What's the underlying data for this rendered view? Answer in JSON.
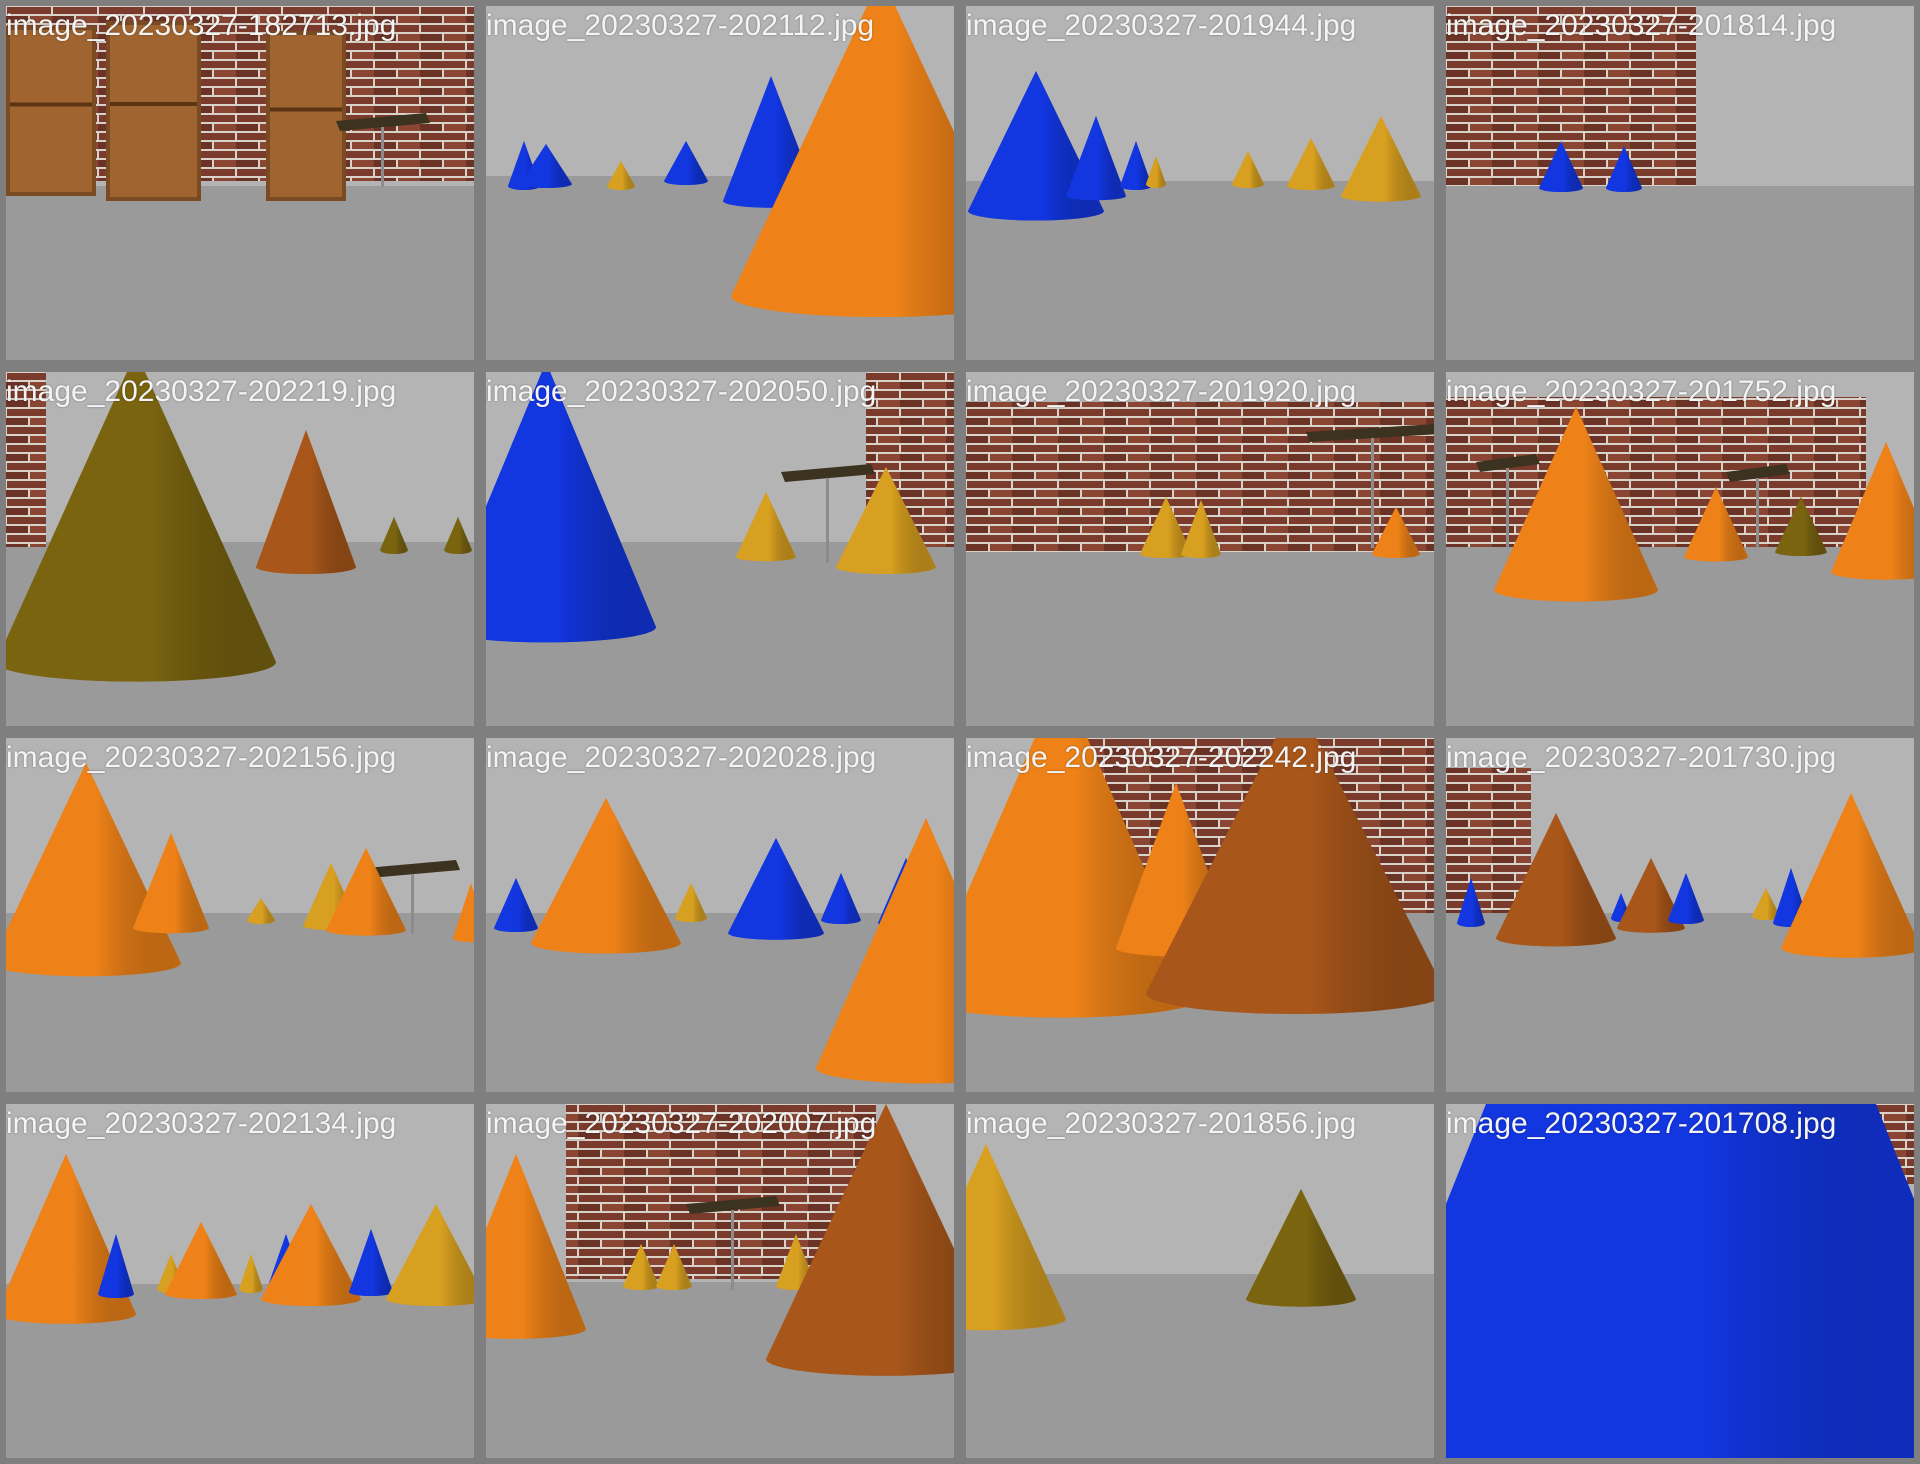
{
  "gallery": {
    "items": [
      {
        "filename": "image_20230327-182713.jpg"
      },
      {
        "filename": "image_20230327-202112.jpg"
      },
      {
        "filename": "image_20230327-201944.jpg"
      },
      {
        "filename": "image_20230327-201814.jpg"
      },
      {
        "filename": "image_20230327-202219.jpg"
      },
      {
        "filename": "image_20230327-202050.jpg"
      },
      {
        "filename": "image_20230327-201920.jpg"
      },
      {
        "filename": "image_20230327-201752.jpg"
      },
      {
        "filename": "image_20230327-202156.jpg"
      },
      {
        "filename": "image_20230327-202028.jpg"
      },
      {
        "filename": "image_20230327-202242.jpg"
      },
      {
        "filename": "image_20230327-201730.jpg"
      },
      {
        "filename": "image_20230327-202134.jpg"
      },
      {
        "filename": "image_20230327-202007.jpg"
      },
      {
        "filename": "image_20230327-201856.jpg"
      },
      {
        "filename": "image_20230327-201708.jpg"
      }
    ]
  },
  "colors": {
    "frame": "#7f7f7f",
    "sky": "#b4b4b4",
    "floor": "#9a9a9a",
    "brick": "#7a3a2c",
    "cone_orange": "#ee8218",
    "cone_blue": "#1236e0",
    "cone_gold": "#d8a020",
    "cone_olive": "#7a6410"
  }
}
